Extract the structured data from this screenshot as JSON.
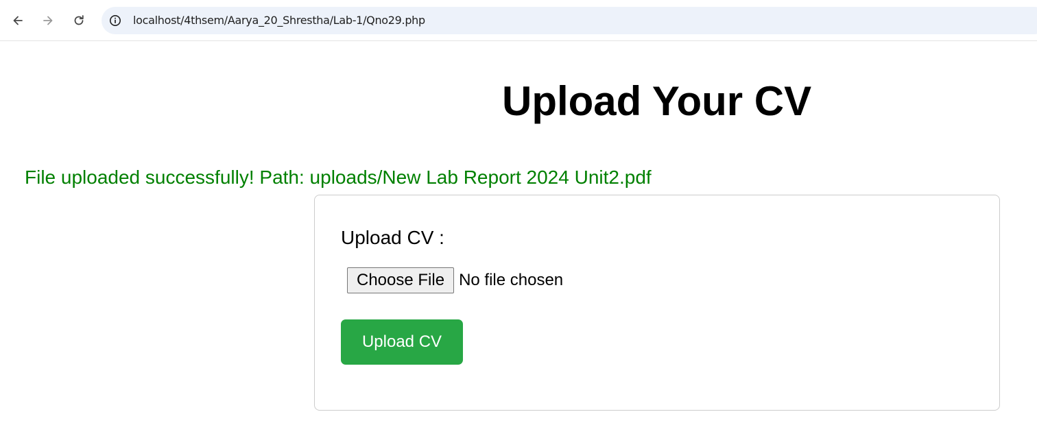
{
  "browser": {
    "url": "localhost/4thsem/Aarya_20_Shrestha/Lab-1/Qno29.php",
    "back_icon": "arrow-left-icon",
    "forward_icon": "arrow-right-icon",
    "reload_icon": "reload-icon",
    "site_info_icon": "info-circle-icon",
    "omnibox_bg": "#edf2fa"
  },
  "page": {
    "title": "Upload Your CV",
    "success_message": "File uploaded successfully! Path: uploads/New Lab Report 2024 Unit2.pdf",
    "success_color": "#008000"
  },
  "form": {
    "label": "Upload CV :",
    "file_input": {
      "button_label": "Choose File",
      "status": "No file chosen"
    },
    "submit_label": "Upload CV",
    "submit_color": "#28a745"
  }
}
